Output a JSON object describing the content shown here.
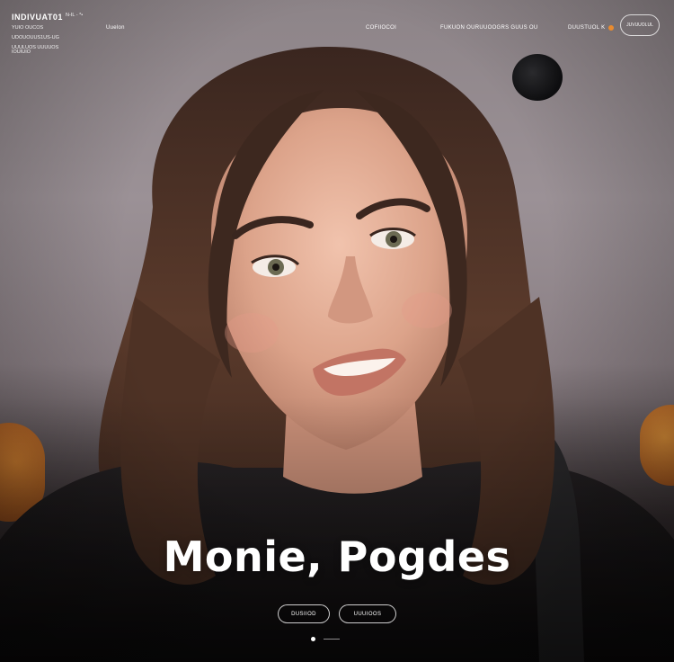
{
  "header": {
    "brand": {
      "name": "INDIVUAT01",
      "subtitle_lines": [
        "YUIO OUCOS",
        "UDOUOUUS1US-UG",
        "UUULUOS UUUUOS"
      ],
      "tag": "N-IL - *•",
      "footer": "IOUIUIO"
    },
    "nav": {
      "language": "Uuelon",
      "links": [
        "COFIIOCOI",
        "FUKUON OURUUOOGRS GUUS OU"
      ],
      "account": "DUUSTUOL K"
    },
    "cta_label": "JUVUUOLUL"
  },
  "hero": {
    "title": "Monie, Pogdes",
    "buttons": [
      "DUSIIOD",
      "UUUIOOS"
    ]
  },
  "pager": {
    "count": 2,
    "active": 0
  },
  "colors": {
    "accent": "#e98b2f",
    "text": "#ffffff"
  },
  "icons": {
    "account_indicator": "orange-dot-icon"
  }
}
